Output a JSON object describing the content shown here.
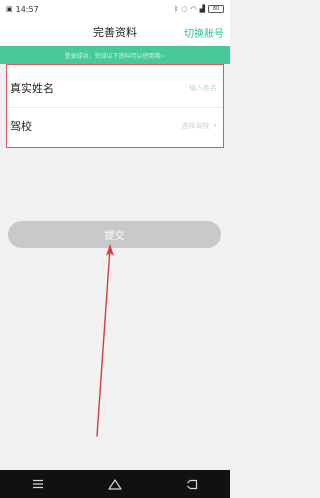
{
  "status_bar": {
    "time": "14:57",
    "battery": "80"
  },
  "header": {
    "title": "完善资料",
    "action_label": "切换账号"
  },
  "notice": {
    "text": "登录成功，完成以下资料可以使用哦~"
  },
  "form": {
    "rows": [
      {
        "label": "真实姓名",
        "placeholder": "输入姓名"
      },
      {
        "label": "驾校",
        "placeholder": "选择驾校"
      }
    ]
  },
  "submit": {
    "label": "提交"
  },
  "colors": {
    "accent": "#34c28e",
    "notice_bg": "#49c997",
    "annotation": "#d93a3a",
    "disabled_button": "#c9c9c9"
  }
}
